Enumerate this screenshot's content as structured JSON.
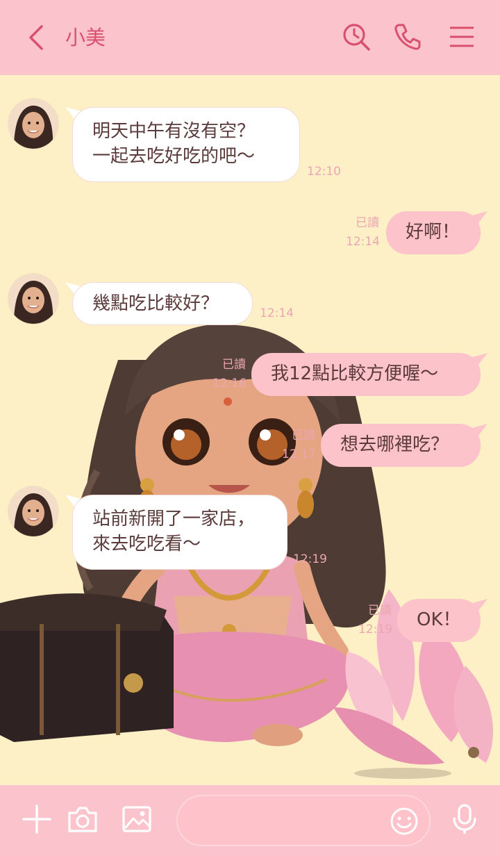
{
  "header": {
    "title": "小美"
  },
  "messages": [
    {
      "side": "in",
      "text": "明天中午有沒有空？\n一起去吃好吃的吧～",
      "time": "12:10"
    },
    {
      "side": "out",
      "text": "好啊！",
      "read": "已讀",
      "time": "12:14"
    },
    {
      "side": "in",
      "text": "幾點吃比較好？",
      "time": "12:14"
    },
    {
      "side": "out",
      "text": "我12點比較方便喔～",
      "read": "已讀",
      "time": "12:16"
    },
    {
      "side": "out",
      "text": "想去哪裡吃？",
      "read": "已讀",
      "time": "12:17"
    },
    {
      "side": "in",
      "text": "站前新開了一家店，\n來去吃吃看～",
      "time": "12:19"
    },
    {
      "side": "out",
      "text": "OK！",
      "read": "已讀",
      "time": "12:19"
    }
  ],
  "colors": {
    "header_bg": "#fbc4cc",
    "accent": "#d9506e",
    "chat_bg": "#fdf0c6",
    "out_bubble": "#fdc3cb",
    "in_bubble": "#ffffff"
  },
  "icons": {
    "back": "chevron-left-icon",
    "search": "search-clock-icon",
    "call": "phone-icon",
    "menu": "hamburger-menu-icon",
    "add": "plus-icon",
    "camera": "camera-icon",
    "image": "image-icon",
    "emoji": "smile-icon",
    "voice": "microphone-icon"
  }
}
